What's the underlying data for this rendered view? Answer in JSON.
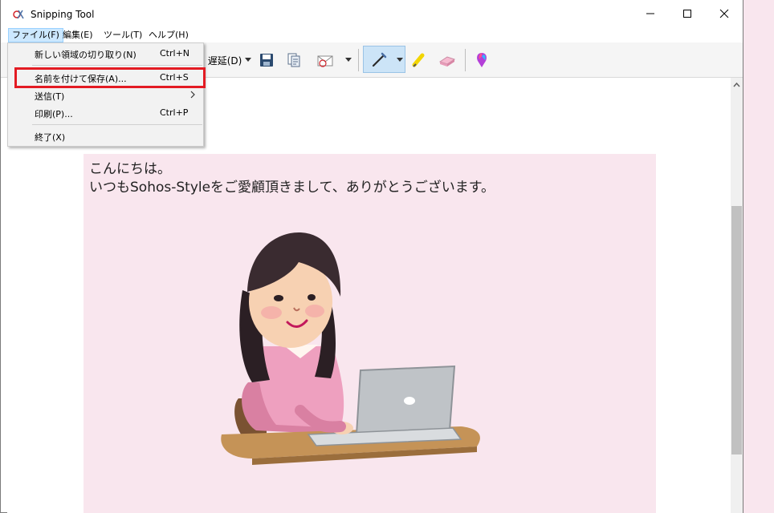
{
  "window": {
    "title": "Snipping Tool"
  },
  "menubar": {
    "items": [
      {
        "label": "ファイル(F)"
      },
      {
        "label": "編集(E)"
      },
      {
        "label": "ツール(T)"
      },
      {
        "label": "ヘルプ(H)"
      }
    ]
  },
  "toolbar": {
    "delay_label": "遅延(D)"
  },
  "file_menu": {
    "items": [
      {
        "label": "新しい領域の切り取り(N)",
        "shortcut": "Ctrl+N"
      },
      {
        "label": "名前を付けて保存(A)...",
        "shortcut": "Ctrl+S"
      },
      {
        "label": "送信(T)",
        "shortcut": ""
      },
      {
        "label": "印刷(P)...",
        "shortcut": "Ctrl+P"
      },
      {
        "label": "終了(X)",
        "shortcut": ""
      }
    ]
  },
  "snip": {
    "line1": "こんにちは。",
    "line2": "いつもSohos-Styleをご愛顧頂きまして、ありがとうございます。"
  },
  "colors": {
    "highlight": "#e31b23",
    "snip_background": "#f9e6ee",
    "active_menu": "#cce8ff"
  }
}
